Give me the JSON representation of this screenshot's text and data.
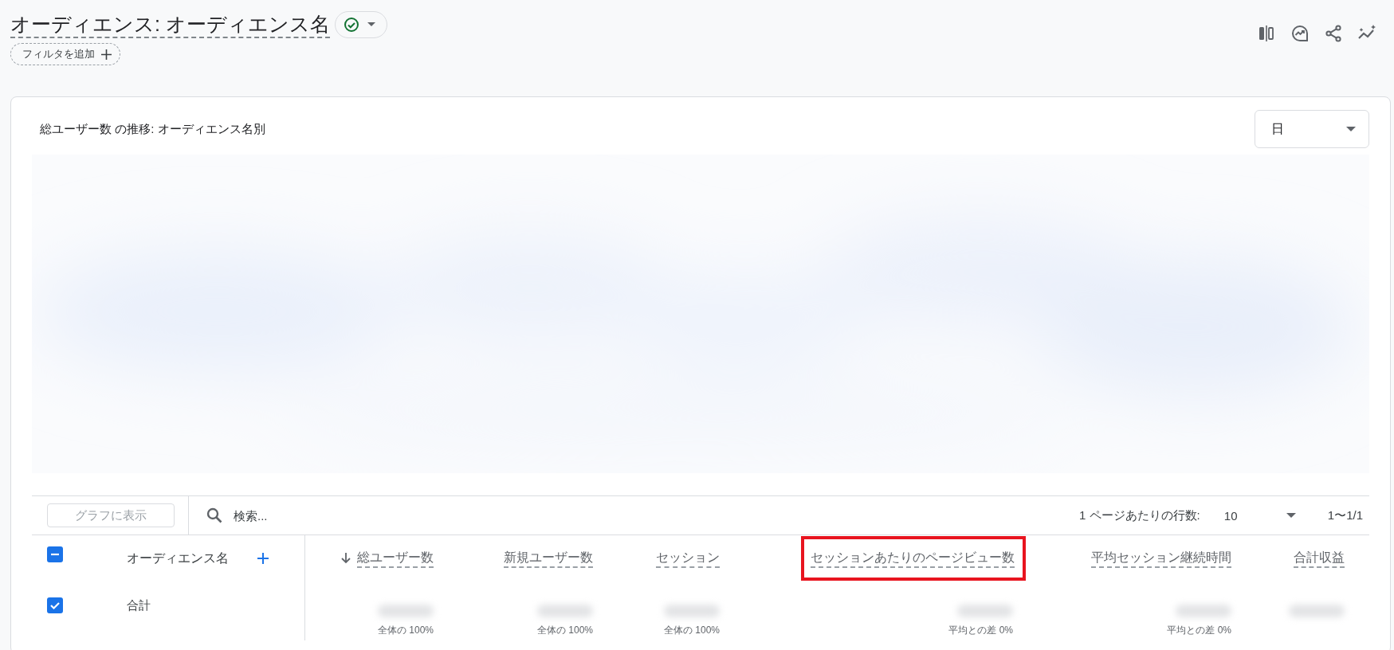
{
  "header": {
    "title": "オーディエンス: オーディエンス名",
    "status_ok": true,
    "filter_button": "フィルタを追加"
  },
  "card": {
    "chart_title": "総ユーザー数 の推移: オーディエンス名別",
    "interval": {
      "value": "日"
    },
    "toolbar": {
      "plot_button": {
        "label": "グラフに表示",
        "disabled": true
      },
      "search": {
        "placeholder": "検索..."
      },
      "rows_per_page_label": "1 ページあたりの行数:",
      "rows_per_page": "10",
      "range": "1〜1/1"
    },
    "table": {
      "header_checkbox_partial": true,
      "dimension_column": "オーディエンス名",
      "columns": [
        {
          "label": "総ユーザー数",
          "sorted": true,
          "highlighted": false
        },
        {
          "label": "新規ユーザー数",
          "sorted": false,
          "highlighted": false
        },
        {
          "label": "セッション",
          "sorted": false,
          "highlighted": false
        },
        {
          "label": "セッションあたりのページビュー数",
          "sorted": false,
          "highlighted": true
        },
        {
          "label": "平均セッション継続時間",
          "sorted": false,
          "highlighted": false
        },
        {
          "label": "合計収益",
          "sorted": false,
          "highlighted": false
        }
      ],
      "rows": [
        {
          "name": "合計",
          "checked": true,
          "cells": [
            {
              "value_hidden": true,
              "note": "全体の 100%"
            },
            {
              "value_hidden": true,
              "note": "全体の 100%"
            },
            {
              "value_hidden": true,
              "note": "全体の 100%"
            },
            {
              "value_hidden": true,
              "note": "平均との差 0%"
            },
            {
              "value_hidden": true,
              "note": "平均との差 0%"
            },
            {
              "value_hidden": true
            }
          ]
        }
      ]
    }
  }
}
